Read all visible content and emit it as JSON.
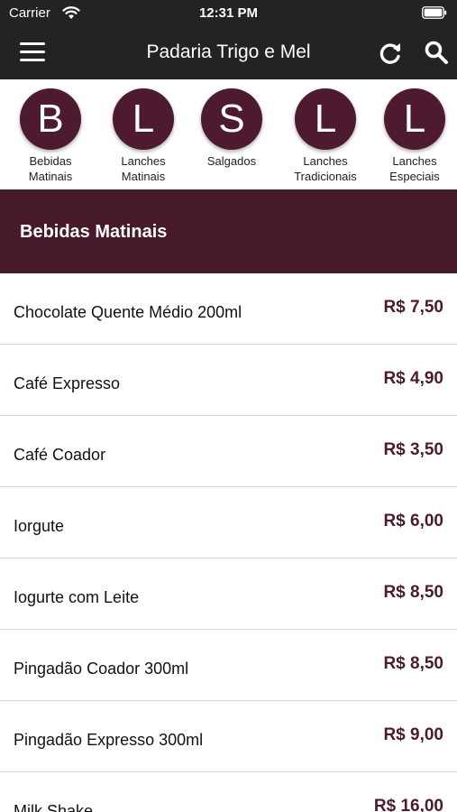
{
  "status": {
    "carrier": "Carrier",
    "time": "12:31 PM"
  },
  "header": {
    "title": "Padaria Trigo e Mel"
  },
  "categories": [
    {
      "letter": "B",
      "label": "Bebidas\nMatinais"
    },
    {
      "letter": "L",
      "label": "Lanches\nMatinais"
    },
    {
      "letter": "S",
      "label": "Salgados"
    },
    {
      "letter": "L",
      "label": "Lanches\nTradicionais"
    },
    {
      "letter": "L",
      "label": "Lanches\nEspeciais"
    }
  ],
  "section": {
    "title": "Bebidas Matinais"
  },
  "items": [
    {
      "name": "Chocolate Quente Médio 200ml",
      "price": "R$ 7,50"
    },
    {
      "name": "Café Expresso",
      "price": "R$ 4,90"
    },
    {
      "name": "Café Coador",
      "price": "R$ 3,50"
    },
    {
      "name": "Iorgute",
      "price": "R$ 6,00"
    },
    {
      "name": "Iogurte com Leite",
      "price": "R$ 8,50"
    },
    {
      "name": "Pingadão Coador 300ml",
      "price": "R$ 8,50"
    },
    {
      "name": "Pingadão Expresso 300ml",
      "price": "R$ 9,00"
    },
    {
      "name": "Milk Shake",
      "price": "R$ 16,00"
    }
  ],
  "colors": {
    "accent": "#4d1a2f",
    "header_bg": "#461a2b",
    "topbar_bg": "#232323"
  },
  "icons": {
    "menu": "hamburger-icon",
    "refresh": "refresh-icon",
    "search": "search-icon"
  }
}
